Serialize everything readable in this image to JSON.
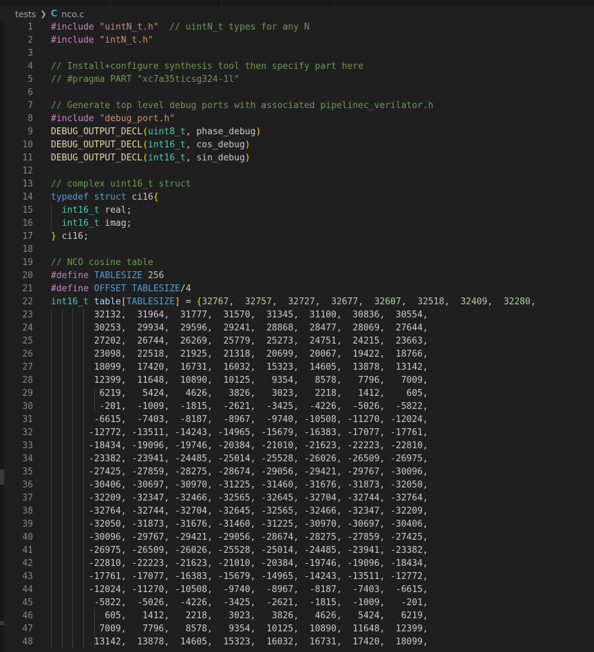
{
  "breadcrumb": {
    "folder": "tests",
    "file": "nco.c",
    "file_icon": "C"
  },
  "lines": [
    {
      "n": "1",
      "tokens": [
        [
          "pp",
          "#include "
        ],
        [
          "str",
          "\"uintN_t.h\""
        ],
        [
          "plain",
          "  "
        ],
        [
          "com",
          "// uintN_t types for any N"
        ]
      ]
    },
    {
      "n": "2",
      "tokens": [
        [
          "pp",
          "#include "
        ],
        [
          "str",
          "\"intN_t.h\""
        ]
      ]
    },
    {
      "n": "3",
      "tokens": []
    },
    {
      "n": "4",
      "tokens": [
        [
          "com",
          "// Install+configure synthesis tool then specify part here"
        ]
      ]
    },
    {
      "n": "5",
      "tokens": [
        [
          "com",
          "// #pragma PART \"xc7a35ticsg324-1l\""
        ]
      ]
    },
    {
      "n": "6",
      "tokens": []
    },
    {
      "n": "7",
      "tokens": [
        [
          "com",
          "// Generate top level debug ports with associated pipelinec_verilator.h"
        ]
      ]
    },
    {
      "n": "8",
      "tokens": [
        [
          "pp",
          "#include "
        ],
        [
          "str",
          "\"debug_port.h\""
        ]
      ]
    },
    {
      "n": "9",
      "tokens": [
        [
          "fn",
          "DEBUG_OUTPUT_DECL"
        ],
        [
          "br1",
          "("
        ],
        [
          "ty",
          "uint8_t"
        ],
        [
          "plain",
          ", phase_debug"
        ],
        [
          "br1",
          ")"
        ]
      ]
    },
    {
      "n": "10",
      "tokens": [
        [
          "fn",
          "DEBUG_OUTPUT_DECL"
        ],
        [
          "br1",
          "("
        ],
        [
          "ty",
          "int16_t"
        ],
        [
          "plain",
          ", cos_debug"
        ],
        [
          "br1",
          ")"
        ]
      ]
    },
    {
      "n": "11",
      "tokens": [
        [
          "fn",
          "DEBUG_OUTPUT_DECL"
        ],
        [
          "br1",
          "("
        ],
        [
          "ty",
          "int16_t"
        ],
        [
          "plain",
          ", sin_debug"
        ],
        [
          "br1",
          ")"
        ]
      ]
    },
    {
      "n": "12",
      "tokens": []
    },
    {
      "n": "13",
      "tokens": [
        [
          "com",
          "// complex uint16_t struct"
        ]
      ]
    },
    {
      "n": "14",
      "tokens": [
        [
          "type",
          "typedef"
        ],
        [
          "plain",
          " "
        ],
        [
          "type",
          "struct"
        ],
        [
          "plain",
          " ci16"
        ],
        [
          "br1",
          "{"
        ]
      ]
    },
    {
      "n": "15",
      "tokens": [
        [
          "plain",
          "  "
        ],
        [
          "ty",
          "int16_t"
        ],
        [
          "plain",
          " real;"
        ]
      ]
    },
    {
      "n": "16",
      "tokens": [
        [
          "plain",
          "  "
        ],
        [
          "ty",
          "int16_t"
        ],
        [
          "plain",
          " imag;"
        ]
      ]
    },
    {
      "n": "17",
      "tokens": [
        [
          "br1",
          "}"
        ],
        [
          "plain",
          " ci16;"
        ]
      ]
    },
    {
      "n": "18",
      "tokens": []
    },
    {
      "n": "19",
      "tokens": [
        [
          "com",
          "// NCO cosine table"
        ]
      ]
    },
    {
      "n": "20",
      "tokens": [
        [
          "pp",
          "#define "
        ],
        [
          "mac",
          "TABLESIZE"
        ],
        [
          "plain",
          " "
        ],
        [
          "num",
          "256"
        ]
      ]
    },
    {
      "n": "21",
      "tokens": [
        [
          "pp",
          "#define "
        ],
        [
          "mac",
          "OFFSET"
        ],
        [
          "plain",
          " "
        ],
        [
          "mac",
          "TABLESIZE"
        ],
        [
          "plain",
          "/"
        ],
        [
          "num",
          "4"
        ]
      ]
    },
    {
      "n": "22",
      "tokens": [
        [
          "ty",
          "int16_t"
        ],
        [
          "plain",
          " "
        ],
        [
          "ident",
          "table"
        ],
        [
          "br1",
          "["
        ],
        [
          "mac",
          "TABLESIZE"
        ],
        [
          "br1",
          "]"
        ],
        [
          "plain",
          " = "
        ],
        [
          "br1",
          "{"
        ],
        [
          "num",
          "32767"
        ],
        [
          "plain",
          ",  "
        ],
        [
          "num",
          "32757"
        ],
        [
          "plain",
          ",  "
        ],
        [
          "num",
          "32727"
        ],
        [
          "plain",
          ",  "
        ],
        [
          "num",
          "32677"
        ],
        [
          "plain",
          ",  "
        ],
        [
          "num",
          "32607"
        ],
        [
          "plain",
          ",  "
        ],
        [
          "num",
          "32518"
        ],
        [
          "plain",
          ",  "
        ],
        [
          "num",
          "32409"
        ],
        [
          "plain",
          ",  "
        ],
        [
          "num",
          "32280"
        ],
        [
          "plain",
          ","
        ]
      ]
    },
    {
      "n": "23",
      "tokens": [
        [
          "plain",
          "        32132,  31964,  31777,  31570,  31345,  31100,  30836,  30554,"
        ]
      ]
    },
    {
      "n": "24",
      "tokens": [
        [
          "plain",
          "        30253,  29934,  29596,  29241,  28868,  28477,  28069,  27644,"
        ]
      ]
    },
    {
      "n": "25",
      "tokens": [
        [
          "plain",
          "        27202,  26744,  26269,  25779,  25273,  24751,  24215,  23663,"
        ]
      ]
    },
    {
      "n": "26",
      "tokens": [
        [
          "plain",
          "        23098,  22518,  21925,  21318,  20699,  20067,  19422,  18766,"
        ]
      ]
    },
    {
      "n": "27",
      "tokens": [
        [
          "plain",
          "        18099,  17420,  16731,  16032,  15323,  14605,  13878,  13142,"
        ]
      ]
    },
    {
      "n": "28",
      "tokens": [
        [
          "plain",
          "        12399,  11648,  10890,  10125,   9354,   8578,   7796,   7009,"
        ]
      ]
    },
    {
      "n": "29",
      "tokens": [
        [
          "plain",
          "         6219,   5424,   4626,   3826,   3023,   2218,   1412,    605,"
        ]
      ]
    },
    {
      "n": "30",
      "tokens": [
        [
          "plain",
          "         -201,  -1009,  -1815,  -2621,  -3425,  -4226,  -5026,  -5822,"
        ]
      ]
    },
    {
      "n": "31",
      "tokens": [
        [
          "plain",
          "        -6615,  -7403,  -8187,  -8967,  -9740, -10508, -11270, -12024,"
        ]
      ]
    },
    {
      "n": "32",
      "tokens": [
        [
          "plain",
          "       -12772, -13511, -14243, -14965, -15679, -16383, -17077, -17761,"
        ]
      ]
    },
    {
      "n": "33",
      "tokens": [
        [
          "plain",
          "       -18434, -19096, -19746, -20384, -21010, -21623, -22223, -22810,"
        ]
      ]
    },
    {
      "n": "34",
      "tokens": [
        [
          "plain",
          "       -23382, -23941, -24485, -25014, -25528, -26026, -26509, -26975,"
        ]
      ]
    },
    {
      "n": "35",
      "tokens": [
        [
          "plain",
          "       -27425, -27859, -28275, -28674, -29056, -29421, -29767, -30096,"
        ]
      ]
    },
    {
      "n": "36",
      "tokens": [
        [
          "plain",
          "       -30406, -30697, -30970, -31225, -31460, -31676, -31873, -32050,"
        ]
      ]
    },
    {
      "n": "37",
      "tokens": [
        [
          "plain",
          "       -32209, -32347, -32466, -32565, -32645, -32704, -32744, -32764,"
        ]
      ]
    },
    {
      "n": "38",
      "tokens": [
        [
          "plain",
          "       -32764, -32744, -32704, -32645, -32565, -32466, -32347, -32209,"
        ]
      ]
    },
    {
      "n": "39",
      "tokens": [
        [
          "plain",
          "       -32050, -31873, -31676, -31460, -31225, -30970, -30697, -30406,"
        ]
      ]
    },
    {
      "n": "40",
      "tokens": [
        [
          "plain",
          "       -30096, -29767, -29421, -29056, -28674, -28275, -27859, -27425,"
        ]
      ]
    },
    {
      "n": "41",
      "tokens": [
        [
          "plain",
          "       -26975, -26509, -26026, -25528, -25014, -24485, -23941, -23382,"
        ]
      ]
    },
    {
      "n": "42",
      "tokens": [
        [
          "plain",
          "       -22810, -22223, -21623, -21010, -20384, -19746, -19096, -18434,"
        ]
      ]
    },
    {
      "n": "43",
      "tokens": [
        [
          "plain",
          "       -17761, -17077, -16383, -15679, -14965, -14243, -13511, -12772,"
        ]
      ]
    },
    {
      "n": "44",
      "tokens": [
        [
          "plain",
          "       -12024, -11270, -10508,  -9740,  -8967,  -8187,  -7403,  -6615,"
        ]
      ]
    },
    {
      "n": "45",
      "tokens": [
        [
          "plain",
          "        -5822,  -5026,  -4226,  -3425,  -2621,  -1815,  -1009,   -201,"
        ]
      ]
    },
    {
      "n": "46",
      "tokens": [
        [
          "plain",
          "          605,   1412,   2218,   3023,   3826,   4626,   5424,   6219,"
        ]
      ]
    },
    {
      "n": "47",
      "tokens": [
        [
          "plain",
          "         7009,   7796,   8578,   9354,  10125,  10890,  11648,  12399,"
        ]
      ]
    },
    {
      "n": "48",
      "tokens": [
        [
          "plain",
          "        13142,  13878,  14605,  15323,  16032,  16731,  17420,  18099,"
        ]
      ]
    }
  ]
}
